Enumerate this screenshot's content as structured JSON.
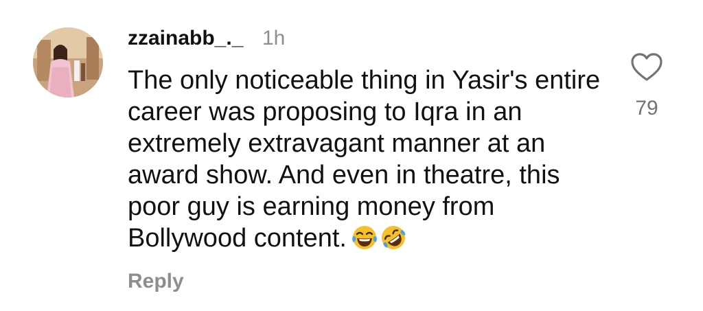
{
  "comment": {
    "username": "zzainabb_._",
    "timestamp": "1h",
    "text": "The only noticeable thing in Yasir's entire career was proposing to Iqra in an extremely extravagant manner at an award show. And even in theatre, this poor guy is earning money from Bollywood content.",
    "emojis": [
      "face-with-tears-of-joy",
      "rolling-on-the-floor-laughing"
    ],
    "reply_label": "Reply",
    "like_count": "79",
    "like_icon": "heart-outline-icon"
  },
  "colors": {
    "text": "#111111",
    "muted": "#8e8e8e",
    "like_count": "#737373",
    "emoji_yellow": "#f7c02b",
    "tears_blue": "#4aa3df"
  }
}
